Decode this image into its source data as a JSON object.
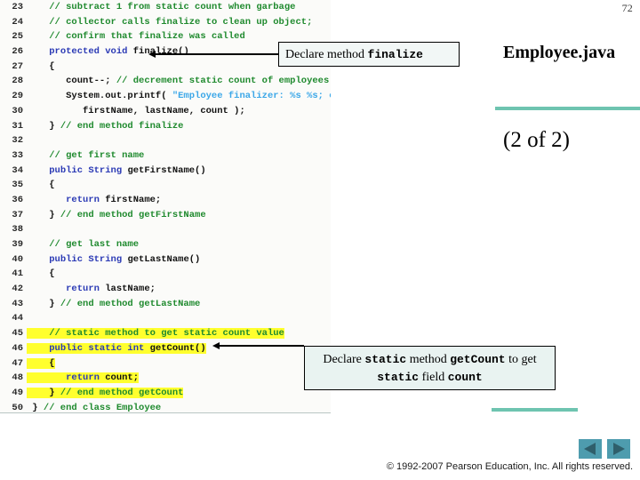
{
  "slide": {
    "page_number": "72",
    "title": "Employee.java",
    "subtitle": "(2 of 2)",
    "accent_color": "#6ec4b0",
    "nav_color": "#4e9cae",
    "footer": "© 1992-2007 Pearson Education, Inc.  All rights reserved."
  },
  "code": {
    "lines": [
      {
        "num": "23",
        "highlight": false,
        "spans": [
          {
            "t": "    ",
            "c": "plain"
          },
          {
            "t": "// subtract 1 from static count when garbage",
            "c": "com"
          }
        ]
      },
      {
        "num": "24",
        "highlight": false,
        "spans": [
          {
            "t": "    ",
            "c": "plain"
          },
          {
            "t": "// collector calls finalize to clean up object;",
            "c": "com"
          }
        ]
      },
      {
        "num": "25",
        "highlight": false,
        "spans": [
          {
            "t": "    ",
            "c": "plain"
          },
          {
            "t": "// confirm that finalize was called",
            "c": "com"
          }
        ]
      },
      {
        "num": "26",
        "highlight": false,
        "spans": [
          {
            "t": "    ",
            "c": "plain"
          },
          {
            "t": "protected void ",
            "c": "key"
          },
          {
            "t": "finalize()",
            "c": "plain"
          }
        ]
      },
      {
        "num": "27",
        "highlight": false,
        "spans": [
          {
            "t": "    {",
            "c": "plain"
          }
        ]
      },
      {
        "num": "28",
        "highlight": false,
        "spans": [
          {
            "t": "       count--; ",
            "c": "plain"
          },
          {
            "t": "// decrement static count of employees",
            "c": "com"
          }
        ]
      },
      {
        "num": "29",
        "highlight": false,
        "spans": [
          {
            "t": "       System.out.printf( ",
            "c": "plain"
          },
          {
            "t": "\"Employee finalizer: %s %s; count = %d\\n\"",
            "c": "str"
          },
          {
            "t": ",",
            "c": "plain"
          }
        ]
      },
      {
        "num": "30",
        "highlight": false,
        "spans": [
          {
            "t": "          firstName, lastName, count );",
            "c": "plain"
          }
        ]
      },
      {
        "num": "31",
        "highlight": false,
        "spans": [
          {
            "t": "    } ",
            "c": "plain"
          },
          {
            "t": "// end method finalize",
            "c": "com"
          }
        ]
      },
      {
        "num": "32",
        "highlight": false,
        "spans": [
          {
            "t": "",
            "c": "plain"
          }
        ]
      },
      {
        "num": "33",
        "highlight": false,
        "spans": [
          {
            "t": "    ",
            "c": "plain"
          },
          {
            "t": "// get first name",
            "c": "com"
          }
        ]
      },
      {
        "num": "34",
        "highlight": false,
        "spans": [
          {
            "t": "    ",
            "c": "plain"
          },
          {
            "t": "public String ",
            "c": "key"
          },
          {
            "t": "getFirstName()",
            "c": "plain"
          }
        ]
      },
      {
        "num": "35",
        "highlight": false,
        "spans": [
          {
            "t": "    {",
            "c": "plain"
          }
        ]
      },
      {
        "num": "36",
        "highlight": false,
        "spans": [
          {
            "t": "       ",
            "c": "plain"
          },
          {
            "t": "return ",
            "c": "key"
          },
          {
            "t": "firstName;",
            "c": "plain"
          }
        ]
      },
      {
        "num": "37",
        "highlight": false,
        "spans": [
          {
            "t": "    } ",
            "c": "plain"
          },
          {
            "t": "// end method getFirstName",
            "c": "com"
          }
        ]
      },
      {
        "num": "38",
        "highlight": false,
        "spans": [
          {
            "t": "",
            "c": "plain"
          }
        ]
      },
      {
        "num": "39",
        "highlight": false,
        "spans": [
          {
            "t": "    ",
            "c": "plain"
          },
          {
            "t": "// get last name",
            "c": "com"
          }
        ]
      },
      {
        "num": "40",
        "highlight": false,
        "spans": [
          {
            "t": "    ",
            "c": "plain"
          },
          {
            "t": "public String ",
            "c": "key"
          },
          {
            "t": "getLastName()",
            "c": "plain"
          }
        ]
      },
      {
        "num": "41",
        "highlight": false,
        "spans": [
          {
            "t": "    {",
            "c": "plain"
          }
        ]
      },
      {
        "num": "42",
        "highlight": false,
        "spans": [
          {
            "t": "       ",
            "c": "plain"
          },
          {
            "t": "return ",
            "c": "key"
          },
          {
            "t": "lastName;",
            "c": "plain"
          }
        ]
      },
      {
        "num": "43",
        "highlight": false,
        "spans": [
          {
            "t": "    } ",
            "c": "plain"
          },
          {
            "t": "// end method getLastName",
            "c": "com"
          }
        ]
      },
      {
        "num": "44",
        "highlight": false,
        "spans": [
          {
            "t": "",
            "c": "plain"
          }
        ]
      },
      {
        "num": "45",
        "highlight": true,
        "spans": [
          {
            "t": "    ",
            "c": "plain"
          },
          {
            "t": "// static method to get static count value",
            "c": "com"
          }
        ]
      },
      {
        "num": "46",
        "highlight": true,
        "spans": [
          {
            "t": "    ",
            "c": "plain"
          },
          {
            "t": "public static int ",
            "c": "key"
          },
          {
            "t": "getCount()",
            "c": "plain"
          }
        ]
      },
      {
        "num": "47",
        "highlight": true,
        "spans": [
          {
            "t": "    {",
            "c": "plain"
          }
        ]
      },
      {
        "num": "48",
        "highlight": true,
        "spans": [
          {
            "t": "       ",
            "c": "plain"
          },
          {
            "t": "return ",
            "c": "key"
          },
          {
            "t": "count;",
            "c": "plain"
          }
        ]
      },
      {
        "num": "49",
        "highlight": true,
        "spans": [
          {
            "t": "    } ",
            "c": "plain"
          },
          {
            "t": "// end method getCount",
            "c": "com"
          }
        ]
      },
      {
        "num": "50",
        "highlight": false,
        "spans": [
          {
            "t": " } ",
            "c": "plain"
          },
          {
            "t": "// end class Employee",
            "c": "com"
          }
        ]
      }
    ]
  },
  "callouts": {
    "first": {
      "part1": "Declare method ",
      "code1": "finalize"
    },
    "second": {
      "part1": "Declare ",
      "code1": "static",
      "part2": " method ",
      "code2": "getCount",
      "part3": " to get ",
      "code3": "static",
      "part4": " field ",
      "code4": "count"
    }
  }
}
